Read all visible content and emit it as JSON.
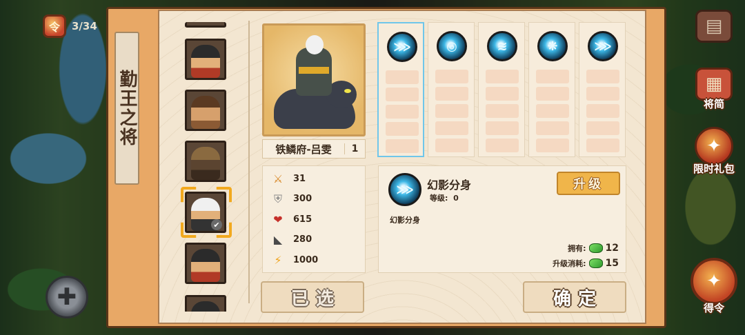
{
  "hud": {
    "level_counter": "3/34",
    "badge_glyph": "令"
  },
  "right_menu": [
    {
      "id": "shop",
      "label": "",
      "icon": "shop-icon"
    },
    {
      "id": "generals_book",
      "label": "将简",
      "icon": "book-icon"
    },
    {
      "id": "gift",
      "label": "限时礼包",
      "icon": "gift-icon"
    },
    {
      "id": "order",
      "label": "得令",
      "icon": "order-seal-icon"
    }
  ],
  "panel": {
    "title": "勤王之将"
  },
  "hero_list": [
    {
      "portrait": "dark-haired-hero"
    },
    {
      "portrait": "brown-haired-hero"
    },
    {
      "portrait": "siege-cart"
    },
    {
      "portrait": "white-haired-rider",
      "selected": true
    },
    {
      "portrait": "dark-haired-hero-2"
    },
    {
      "portrait": "partial-hero"
    }
  ],
  "hero": {
    "name": "铁鳞府-吕雯",
    "level": "1",
    "stats": [
      {
        "icon": "sword-icon",
        "glyph": "⚔",
        "value": "31",
        "color": "#d98a2b"
      },
      {
        "icon": "shield-icon",
        "glyph": "⛨",
        "value": "300",
        "color": "#8a8a8a"
      },
      {
        "icon": "heart-icon",
        "glyph": "❤",
        "value": "615",
        "color": "#c6302a"
      },
      {
        "icon": "boot-icon",
        "glyph": "◣",
        "value": "280",
        "color": "#4a4a4a"
      },
      {
        "icon": "lightning-icon",
        "glyph": "⚡",
        "value": "1000",
        "color": "#f0a41e"
      }
    ]
  },
  "skills": [
    {
      "icon": "phantom-clone-skill-icon",
      "glyph": "⋙",
      "active": true
    },
    {
      "icon": "vortex-skill-icon",
      "glyph": "◎"
    },
    {
      "icon": "wave-skill-icon",
      "glyph": "≋"
    },
    {
      "icon": "wing-skill-icon",
      "glyph": "❋"
    },
    {
      "icon": "claw-skill-icon",
      "glyph": "⋙"
    }
  ],
  "skill_detail": {
    "name": "幻影分身",
    "level_label": "等级:",
    "level_value": "0",
    "description": "幻影分身",
    "upgrade_label": "升级",
    "owned_label": "拥有:",
    "owned_value": "12",
    "cost_label": "升级消耗:",
    "cost_value": "15"
  },
  "buttons": {
    "selected": "已选",
    "confirm": "确定"
  }
}
